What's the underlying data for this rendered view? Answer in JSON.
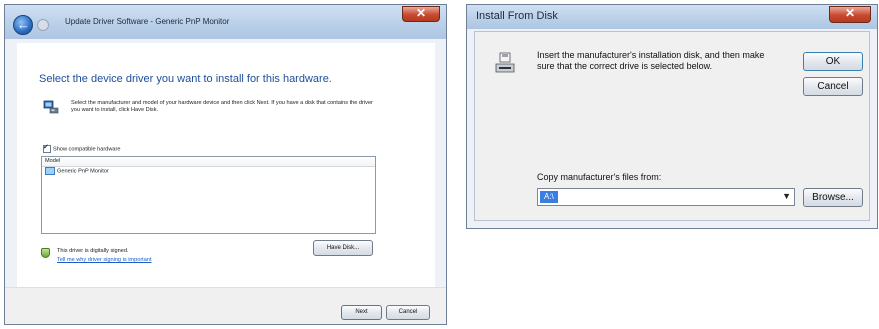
{
  "update_driver": {
    "title": "Update Driver Software - Generic PnP Monitor",
    "heading": "Select the device driver you want to install for this hardware.",
    "description": "Select the manufacturer and model of your hardware device and then click Next. If you have a disk that contains the driver you want to install, click Have Disk.",
    "show_compatible_label": "Show compatible hardware",
    "list": {
      "column_header": "Model",
      "rows": [
        "Generic PnP Monitor"
      ]
    },
    "signed_text": "This driver is digitally signed.",
    "signing_link": "Tell me why driver signing is important",
    "have_disk_label": "Have Disk...",
    "next_label": "Next",
    "cancel_label": "Cancel"
  },
  "install_from_disk": {
    "title": "Install From Disk",
    "message": "Insert the manufacturer's installation disk, and then make sure that the correct drive is selected below.",
    "ok_label": "OK",
    "cancel_label": "Cancel",
    "copy_label": "Copy manufacturer's files from:",
    "combo_value": "A:\\",
    "browse_label": "Browse..."
  },
  "icons": {
    "close": "close-icon",
    "back": "back-arrow-icon",
    "hardware": "hardware-icon",
    "monitor": "monitor-icon",
    "shield": "shield-icon",
    "floppy": "floppy-drive-icon",
    "dropdown": "chevron-down-icon"
  },
  "colors": {
    "heading_blue": "#1e4e9b",
    "link_blue": "#1a5cc8",
    "close_red": "#c84a2f",
    "selection_blue": "#3a7ee0"
  }
}
